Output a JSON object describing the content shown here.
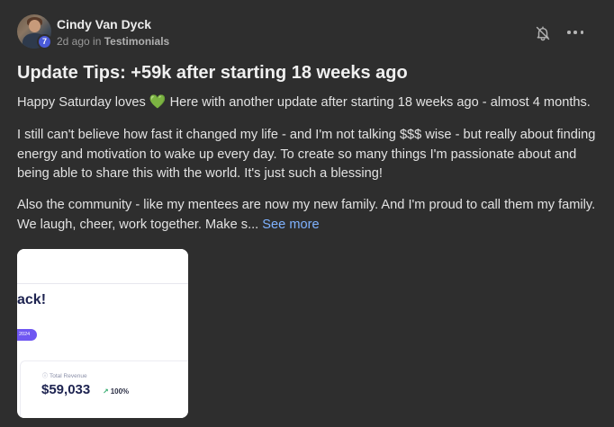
{
  "author": {
    "name": "Cindy Van Dyck",
    "level": "7",
    "time": "2d ago",
    "in_word": "in",
    "category": "Testimonials"
  },
  "actions": {
    "bell_icon": "bell-off-icon",
    "more_icon": "more-horizontal-icon"
  },
  "post": {
    "title": "Update Tips: +59k after starting 18 weeks ago",
    "p1_before": "Happy Saturday loves",
    "p1_emoji": "💚",
    "p1_after": "Here with another update after starting 18 weeks ago - almost 4 months.",
    "p2": "I still can't believe how fast it changed my life - and I'm not talking $$$ wise - but really about finding energy and motivation to wake up every day. To create so many things I'm passionate about and being able to share this with the world. It's just such a blessing!",
    "p3": "Also the community - like my mentees are now my new family. And I'm proud to call them my family. We laugh, cheer, work together. Make s...",
    "see_more": "See more"
  },
  "image": {
    "heading_fragment": "ack!",
    "pill_text": "2024",
    "revenue_label": "Total Revenue",
    "revenue_value": "$59,033",
    "revenue_change": "100%"
  },
  "colors": {
    "background": "#2e2e2e",
    "link": "#7fb2ff",
    "badge": "#4a5ad8",
    "heart": "#2fc12f",
    "pill": "#6f57f2"
  }
}
